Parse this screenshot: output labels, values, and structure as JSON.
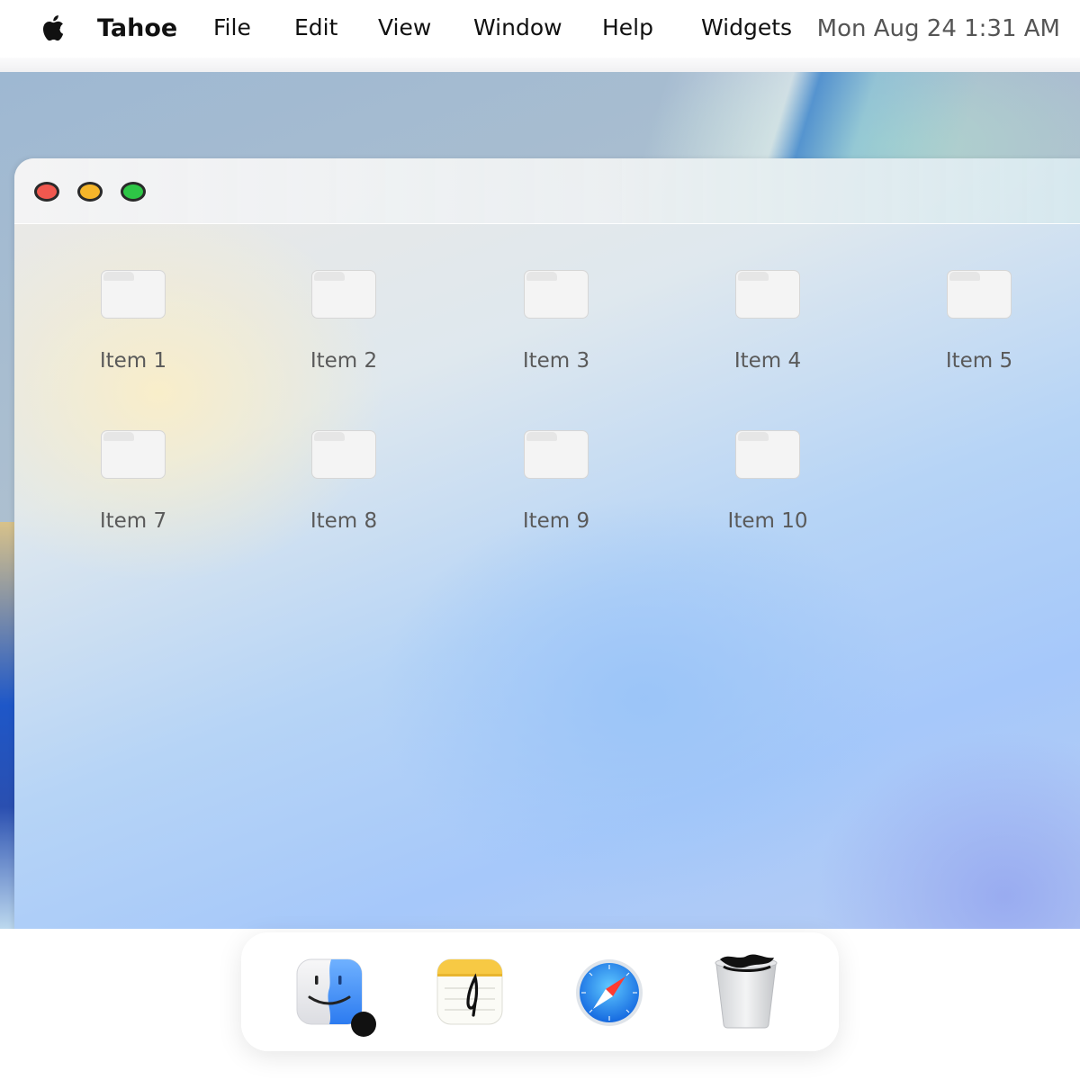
{
  "menubar": {
    "app_name": "Tahoe",
    "menus": [
      "File",
      "Edit",
      "View",
      "Window",
      "Help",
      "Widgets"
    ],
    "clock": "Mon Aug 24 1:31 AM"
  },
  "window": {
    "controls": [
      "close",
      "minimize",
      "maximize"
    ],
    "items": [
      {
        "label": "Item 1"
      },
      {
        "label": "Item 2"
      },
      {
        "label": "Item 3"
      },
      {
        "label": "Item 4"
      },
      {
        "label": "Item 5"
      },
      {
        "label": "Item 7"
      },
      {
        "label": "Item 8"
      },
      {
        "label": "Item 9"
      },
      {
        "label": "Item 10"
      }
    ]
  },
  "dock": {
    "apps": [
      {
        "name": "finder-icon",
        "running": true
      },
      {
        "name": "notes-icon",
        "running": false
      },
      {
        "name": "safari-icon",
        "running": false
      },
      {
        "name": "trash-icon",
        "running": false
      }
    ]
  },
  "colors": {
    "close": "#f0584f",
    "minimize": "#f5b52a",
    "maximize": "#2ec646"
  }
}
